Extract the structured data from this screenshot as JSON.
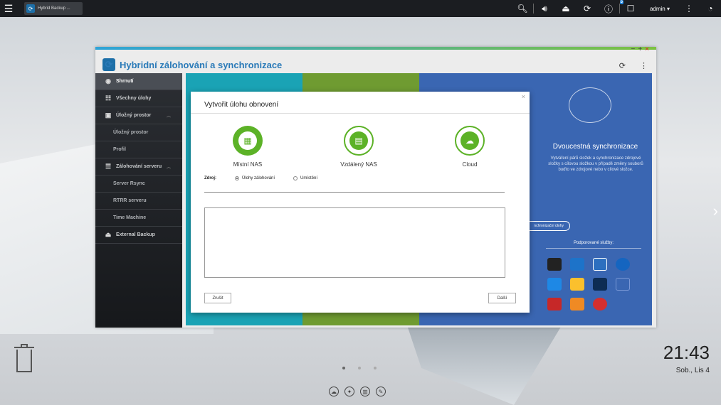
{
  "taskbar": {
    "tab_label": "Hybrid Backup ..."
  },
  "topbar": {
    "user": "admin ▾",
    "notification_count": "5"
  },
  "window": {
    "title": "Hybridní zálohování a synchronizace"
  },
  "sidebar": {
    "items": [
      {
        "label": "Shrnutí"
      },
      {
        "label": "Všechny úlohy"
      },
      {
        "label": "Úložný prostor"
      },
      {
        "label": "Úložný prostor"
      },
      {
        "label": "Profil"
      },
      {
        "label": "Zálohování serveru"
      },
      {
        "label": "Server Rsync"
      },
      {
        "label": "RTRR serveru"
      },
      {
        "label": "Time Machine"
      },
      {
        "label": "External Backup"
      }
    ]
  },
  "panel": {
    "sync_title": "Dvoucestná synchronizace",
    "sync_desc": "Vytváření párů složek a synchronizace zdrojové složky s cílovou složkou v případě změny souborů buďto ve zdrojové nebo v cílové složce.",
    "sync_button": "nchronizační úlohy",
    "supported": "Podporované služby:"
  },
  "dialog": {
    "title": "Vytvořit úlohu obnovení",
    "options": [
      "Místní NAS",
      "Vzdálený NAS",
      "Cloud"
    ],
    "source_label": "Zdroj:",
    "radio1": "Úlohy zálohování",
    "radio2": "Umístění",
    "cancel": "Zrušit",
    "next": "Další"
  },
  "desktop": {
    "time": "21:43",
    "date": "Sob., Lis 4"
  },
  "colors": {
    "accent_green": "#5cb227",
    "teal": "#1aa3b5",
    "olive": "#6f9b31",
    "blue": "#3a66b2"
  }
}
